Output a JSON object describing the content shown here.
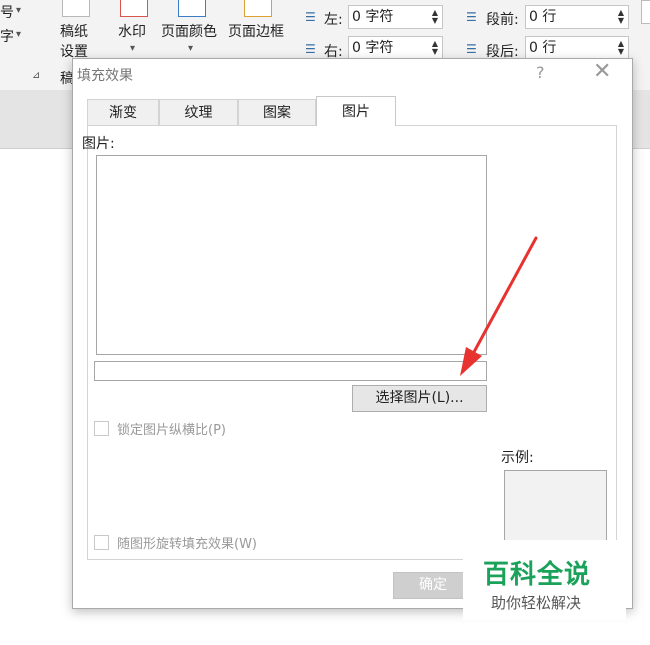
{
  "ribbon": {
    "left_partial": {
      "line1": "号",
      "line2": "字"
    },
    "manuscript": {
      "line1": "稿纸",
      "line2": "设置",
      "group_label": "稿"
    },
    "watermark_label": "水印",
    "page_color_label": "页面颜色",
    "page_border_label": "页面边框",
    "indent_left_label": "左:",
    "indent_left_value": "0 字符",
    "indent_right_label": "右:",
    "indent_right_value": "0 字符",
    "spacing_before_label": "段前:",
    "spacing_before_value": "0 行",
    "spacing_after_label": "段后:",
    "spacing_after_value": "0 行"
  },
  "dialog": {
    "title": "填充效果",
    "help": "?",
    "close": "✕",
    "tabs": [
      {
        "label": "渐变",
        "active": false
      },
      {
        "label": "纹理",
        "active": false
      },
      {
        "label": "图案",
        "active": false
      },
      {
        "label": "图片",
        "active": true
      }
    ],
    "picture_label": "图片:",
    "path_value": "",
    "select_button": "选择图片(L)...",
    "lock_aspect_label": "锁定图片纵横比(P)",
    "rotate_fill_label": "随图形旋转填充效果(W)",
    "sample_label": "示例:",
    "ok_button": "确定"
  },
  "watermark": {
    "brand": "百科全说",
    "slogan": "助你轻松解决"
  },
  "colors": {
    "arrow": "#e8322f",
    "brand_green": "#1aa25a"
  }
}
